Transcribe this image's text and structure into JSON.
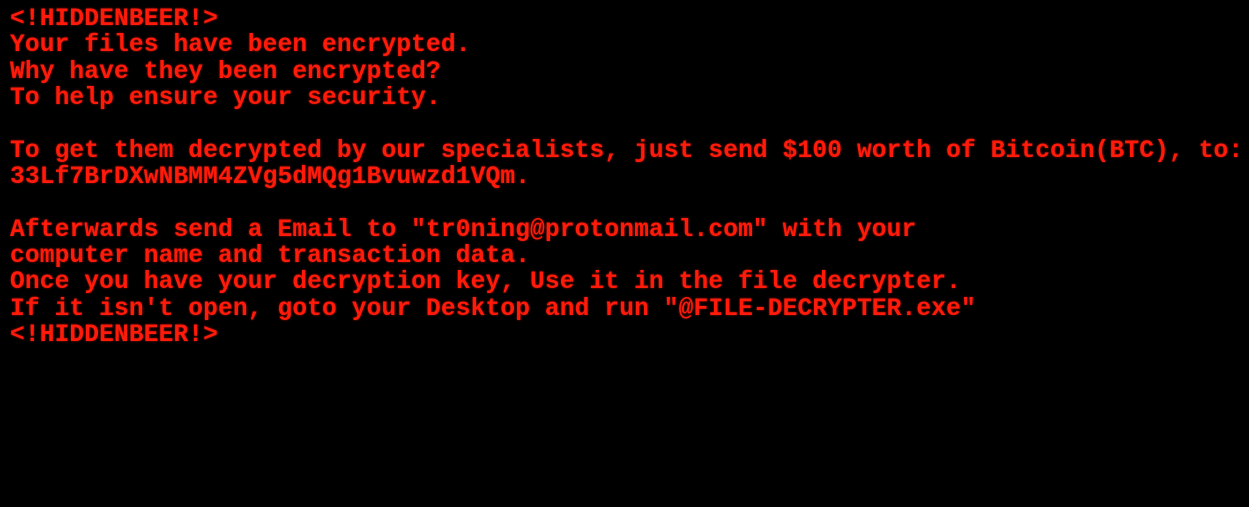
{
  "text_color": "#ff1a0a",
  "background_color": "#000000",
  "lines": [
    "<!HIDDENBEER!>",
    "Your files have been encrypted.",
    "Why have they been encrypted?",
    "To help ensure your security.",
    "",
    "To get them decrypted by our specialists, just send $100 worth of Bitcoin(BTC), to:",
    "33Lf7BrDXwNBMM4ZVg5dMQg1Bvuwzd1VQm.",
    "",
    "Afterwards send a Email to \"tr0ning@protonmail.com\" with your",
    "computer name and transaction data.",
    "Once you have your decryption key, Use it in the file decrypter.",
    "If it isn't open, goto your Desktop and run \"@FILE-DECRYPTER.exe\"",
    "<!HIDDENBEER!>"
  ]
}
